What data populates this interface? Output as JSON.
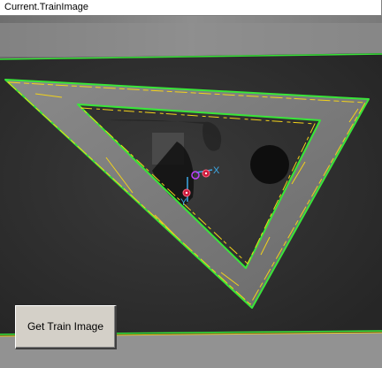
{
  "window": {
    "title": "Current.TrainImage"
  },
  "image_view": {
    "overlay_color_edges": "#39e639",
    "overlay_color_fit": "#f2d21a",
    "marker_color": "#cc1a3c",
    "axis_color": "#3da9e6",
    "axis_label_x": "X",
    "axis_label_y": "Y"
  },
  "buttons": {
    "get_train_image_label": "Get Train Image"
  }
}
